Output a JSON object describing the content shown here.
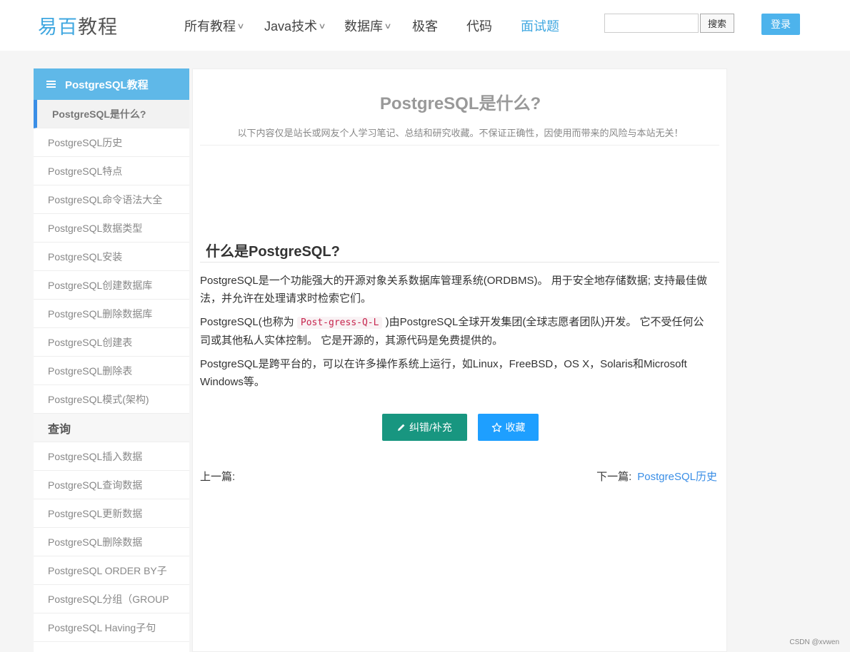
{
  "header": {
    "logo_part1": "易百",
    "logo_part2": "教程",
    "nav": [
      {
        "label": "所有教程",
        "caret": true
      },
      {
        "label": "Java技术",
        "caret": true
      },
      {
        "label": "数据库",
        "caret": true
      },
      {
        "label": "极客",
        "caret": false
      },
      {
        "label": "代码",
        "caret": false
      },
      {
        "label": "面试题",
        "caret": false,
        "active": true
      }
    ],
    "search_value": "",
    "search_button": "搜索",
    "login_button": "登录"
  },
  "sidebar": {
    "title": "PostgreSQL教程",
    "current": "PostgreSQL是什么?",
    "items": [
      "PostgreSQL历史",
      "PostgreSQL特点",
      "PostgreSQL命令语法大全",
      "PostgreSQL数据类型",
      "PostgreSQL安装",
      "PostgreSQL创建数据库",
      "PostgreSQL删除数据库",
      "PostgreSQL创建表",
      "PostgreSQL删除表",
      "PostgreSQL模式(架构)"
    ],
    "section": "查询",
    "section_items": [
      "PostgreSQL插入数据",
      "PostgreSQL查询数据",
      "PostgreSQL更新数据",
      "PostgreSQL删除数据",
      "PostgreSQL ORDER BY子",
      "PostgreSQL分组（GROUP",
      "PostgreSQL Having子句"
    ]
  },
  "article": {
    "title": "PostgreSQL是什么?",
    "disclaimer": "以下内容仅是站长或网友个人学习笔记、总结和研究收藏。不保证正确性，因使用而带来的风险与本站无关！",
    "heading": "什么是PostgreSQL?",
    "p1": "PostgreSQL是一个功能强大的开源对象关系数据库管理系统(ORDBMS)。 用于安全地存储数据; 支持最佳做法，并允许在处理请求时检索它们。",
    "p2_before": "PostgreSQL(也称为 ",
    "p2_code": "Post-gress-Q-L",
    "p2_after": " )由PostgreSQL全球开发集团(全球志愿者团队)开发。 它不受任何公司或其他私人实体控制。 它是开源的，其源代码是免费提供的。",
    "p3": "PostgreSQL是跨平台的，可以在许多操作系统上运行，如Linux，FreeBSD，OS X，Solaris和Microsoft Windows等。",
    "correct_button": "纠错/补充",
    "favorite_button": "收藏",
    "prev_label": "上一篇:",
    "next_label": "下一篇:",
    "next_link": "PostgreSQL历史"
  },
  "watermark": "CSDN @xvwen",
  "colors": {
    "brand": "#3fa7e0",
    "sidebar_header": "#5fb8e8",
    "correct_button": "#189680",
    "favorite_button": "#1e9fff",
    "code_text": "#c7254e"
  }
}
